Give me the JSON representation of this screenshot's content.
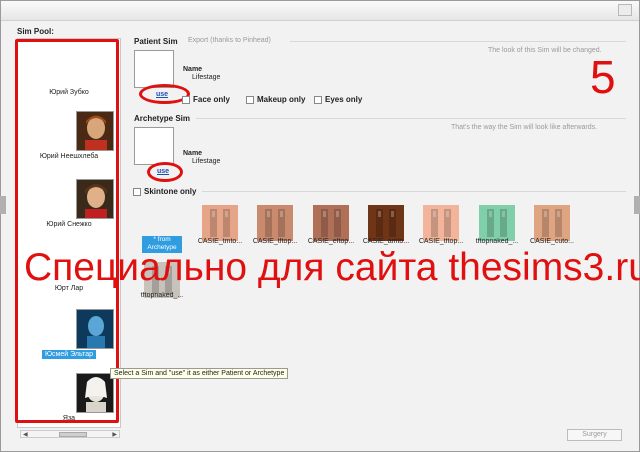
{
  "pool": {
    "label": "Sim Pool:",
    "items": [
      {
        "name": "Юрий Зубко"
      },
      {
        "name": "Юрий Неешхлеба"
      },
      {
        "name": "Юрий Снежко"
      },
      {
        "name": "Юрт Лар"
      },
      {
        "name": "Юсмей Эльтар"
      },
      {
        "name": "Яза"
      }
    ]
  },
  "patient": {
    "title": "Patient Sim",
    "export_label": "Export (thanks to Pinhead)",
    "hint": "The look of this Sim will be changed.",
    "name_label": "Name",
    "lifestage_label": "Lifestage",
    "use_label": "use",
    "checks": [
      "Face only",
      "Makeup only",
      "Eyes only"
    ]
  },
  "archetype": {
    "title": "Archetype Sim",
    "hint": "That's the way the Sim will look like afterwards.",
    "name_label": "Name",
    "lifestage_label": "Lifestage",
    "use_label": "use"
  },
  "skintone": {
    "label": "Skintone only",
    "from_archetype": "* from Archetype",
    "tiles": [
      {
        "label": "CASIE_tmto...",
        "color": "#e6a488"
      },
      {
        "label": "CASIE_tftop...",
        "color": "#c98a6e"
      },
      {
        "label": "CASIE_eftop...",
        "color": "#b07058"
      },
      {
        "label": "CASIE_amto...",
        "color": "#6e3516"
      },
      {
        "label": "CASIE_tftop...",
        "color": "#f2b49a"
      },
      {
        "label": "tftopnaked_...",
        "color": "#7fcfa8"
      },
      {
        "label": "CASIE_cuto...",
        "color": "#dfa482"
      },
      {
        "label": "tftopnaked_...",
        "color": "#c8c2bc"
      }
    ]
  },
  "annotation": {
    "number": "5",
    "watermark": "Специально для сайта thesims3.ru"
  },
  "tooltip": "Select a Sim and \"use\" it as either Patient or Archetype",
  "surgery_label": "Surgery"
}
